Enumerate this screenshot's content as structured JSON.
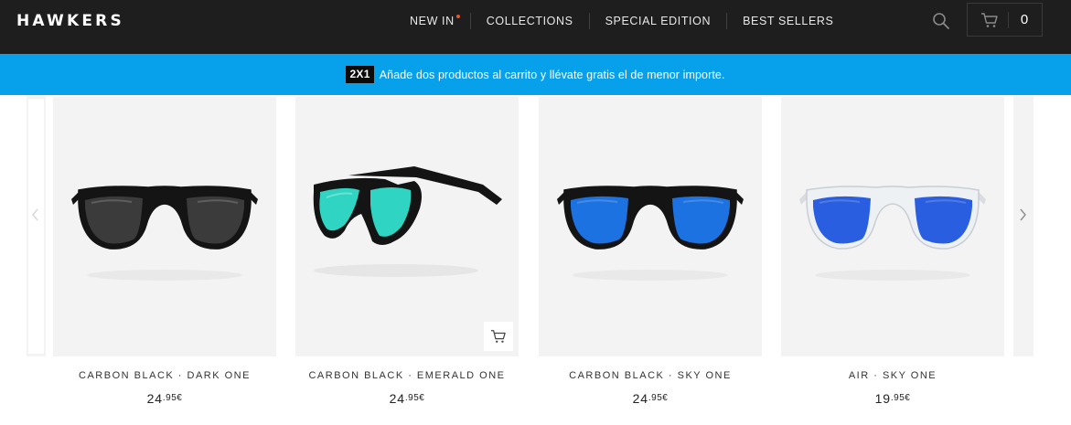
{
  "header": {
    "logo": "HAWKERS",
    "nav": [
      {
        "label": "NEW IN",
        "has_dot": true
      },
      {
        "label": "COLLECTIONS"
      },
      {
        "label": "SPECIAL EDITION"
      },
      {
        "label": "BEST SELLERS"
      }
    ],
    "search_icon": "search-icon",
    "cart_icon": "cart-icon",
    "cart_count": "0"
  },
  "promo": {
    "badge": "2X1",
    "text": "Añade dos productos al carrito y llévate gratis el de menor importe."
  },
  "products": [
    {
      "name": "CARBON BLACK · DARK ONE",
      "price_int": "24",
      "price_dec": ".95€",
      "frame": "#141414",
      "lens": "#3b3b3b",
      "view": "front"
    },
    {
      "name": "CARBON BLACK · EMERALD ONE",
      "price_int": "24",
      "price_dec": ".95€",
      "frame": "#141414",
      "lens": "#2fd5c2",
      "view": "angled",
      "quick_add": true
    },
    {
      "name": "CARBON BLACK · SKY ONE",
      "price_int": "24",
      "price_dec": ".95€",
      "frame": "#141414",
      "lens": "#1b72e0",
      "view": "front"
    },
    {
      "name": "AIR · SKY ONE",
      "price_int": "19",
      "price_dec": ".95€",
      "frame": "#e6eaee",
      "lens": "#2a5ee0",
      "view": "front"
    }
  ],
  "colors": {
    "header_bg": "#1e1e1e",
    "promo_bg": "#07a0ea",
    "nav_dot": "#e8572a",
    "card_bg": "#f3f3f3"
  }
}
